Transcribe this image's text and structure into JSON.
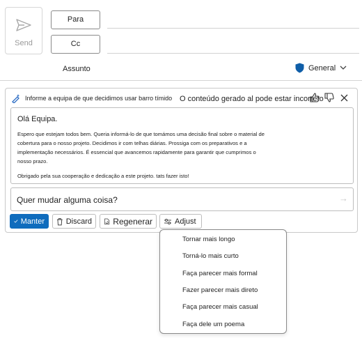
{
  "compose": {
    "send_label": "Send",
    "to_label": "Para",
    "cc_label": "Cc",
    "subject_label": "Assunto",
    "sensitivity_label": "General"
  },
  "copilot": {
    "prompt": "Informe a equipa de que decidimos usar barro tímido",
    "disclaimer": "O conteúdo gerado al pode estar incorreto",
    "draft": {
      "greeting": "Olá Equipa.",
      "lines": [
        "Espero que estejam todos bem. Queria informá-lo de que tomámos uma decisão final sobre o material de",
        "cobertura para o nosso projeto. Decidimos ir com telhas diárias. Prossiga com os preparativos e a",
        "implementação necessários. É essencial que avancemos rapidamente para garantir que cumprimos o",
        "nosso prazo."
      ],
      "closing": "Obrigado pela sua cooperação e dedicação a este projeto. tats fazer isto!"
    },
    "ask_placeholder": "Quer mudar alguma coisa?",
    "buttons": {
      "keep": "Manter",
      "discard": "Discard",
      "regenerate": "Regenerar",
      "adjust": "Adjust"
    },
    "adjust_menu": [
      "Tornar mais longo",
      "Torná-lo mais curto",
      "Faça parecer mais formal",
      "Fazer parecer mais direto",
      "Faça parecer mais casual",
      "Faça dele um poema"
    ]
  },
  "colors": {
    "accent": "#0f6cbd"
  },
  "icons": [
    "send-icon",
    "shield-icon",
    "chevron-down-icon",
    "copilot-pen-icon",
    "thumbs-up-icon",
    "thumbs-down-icon",
    "close-icon",
    "send-arrow-icon",
    "checkmark-icon",
    "trash-icon",
    "regenerate-icon",
    "sliders-icon"
  ]
}
